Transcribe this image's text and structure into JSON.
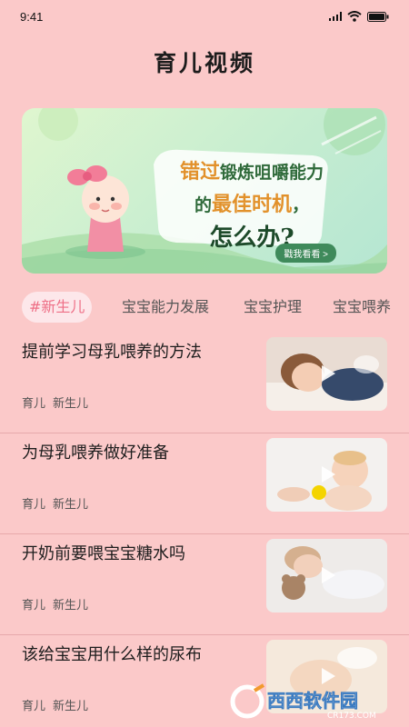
{
  "status": {
    "time": "9:41"
  },
  "app": {
    "title": "育儿视频"
  },
  "banner": {
    "line1_highlight": "错过",
    "line1_rest": "锻炼咀嚼能力",
    "line2_prefix": "的",
    "line2_highlight": "最佳时机",
    "line2_suffix": "，",
    "line3": "怎么办?",
    "cta": "戳我看看 >"
  },
  "tabs": [
    {
      "label": "#新生儿",
      "active": true
    },
    {
      "label": "宝宝能力发展",
      "active": false
    },
    {
      "label": "宝宝护理",
      "active": false
    },
    {
      "label": "宝宝喂养",
      "active": false
    }
  ],
  "articles": [
    {
      "title": "提前学习母乳喂养的方法",
      "tags": [
        "育儿",
        "新生儿"
      ]
    },
    {
      "title": "为母乳喂养做好准备",
      "tags": [
        "育儿",
        "新生儿"
      ]
    },
    {
      "title": "开奶前要喂宝宝糖水吗",
      "tags": [
        "育儿",
        "新生儿"
      ]
    },
    {
      "title": "该给宝宝用什么样的尿布",
      "tags": [
        "育儿",
        "新生儿"
      ]
    }
  ],
  "watermark": {
    "brand": "西西软件园",
    "url": "CR173.COM"
  },
  "icons": {
    "signal": "signal-icon",
    "wifi": "wifi-icon",
    "battery": "battery-icon",
    "play": "play-icon"
  },
  "colors": {
    "background": "#fbc9c9",
    "active_tab_text": "#ee6f86",
    "active_tab_bg": "#fde7ea"
  }
}
